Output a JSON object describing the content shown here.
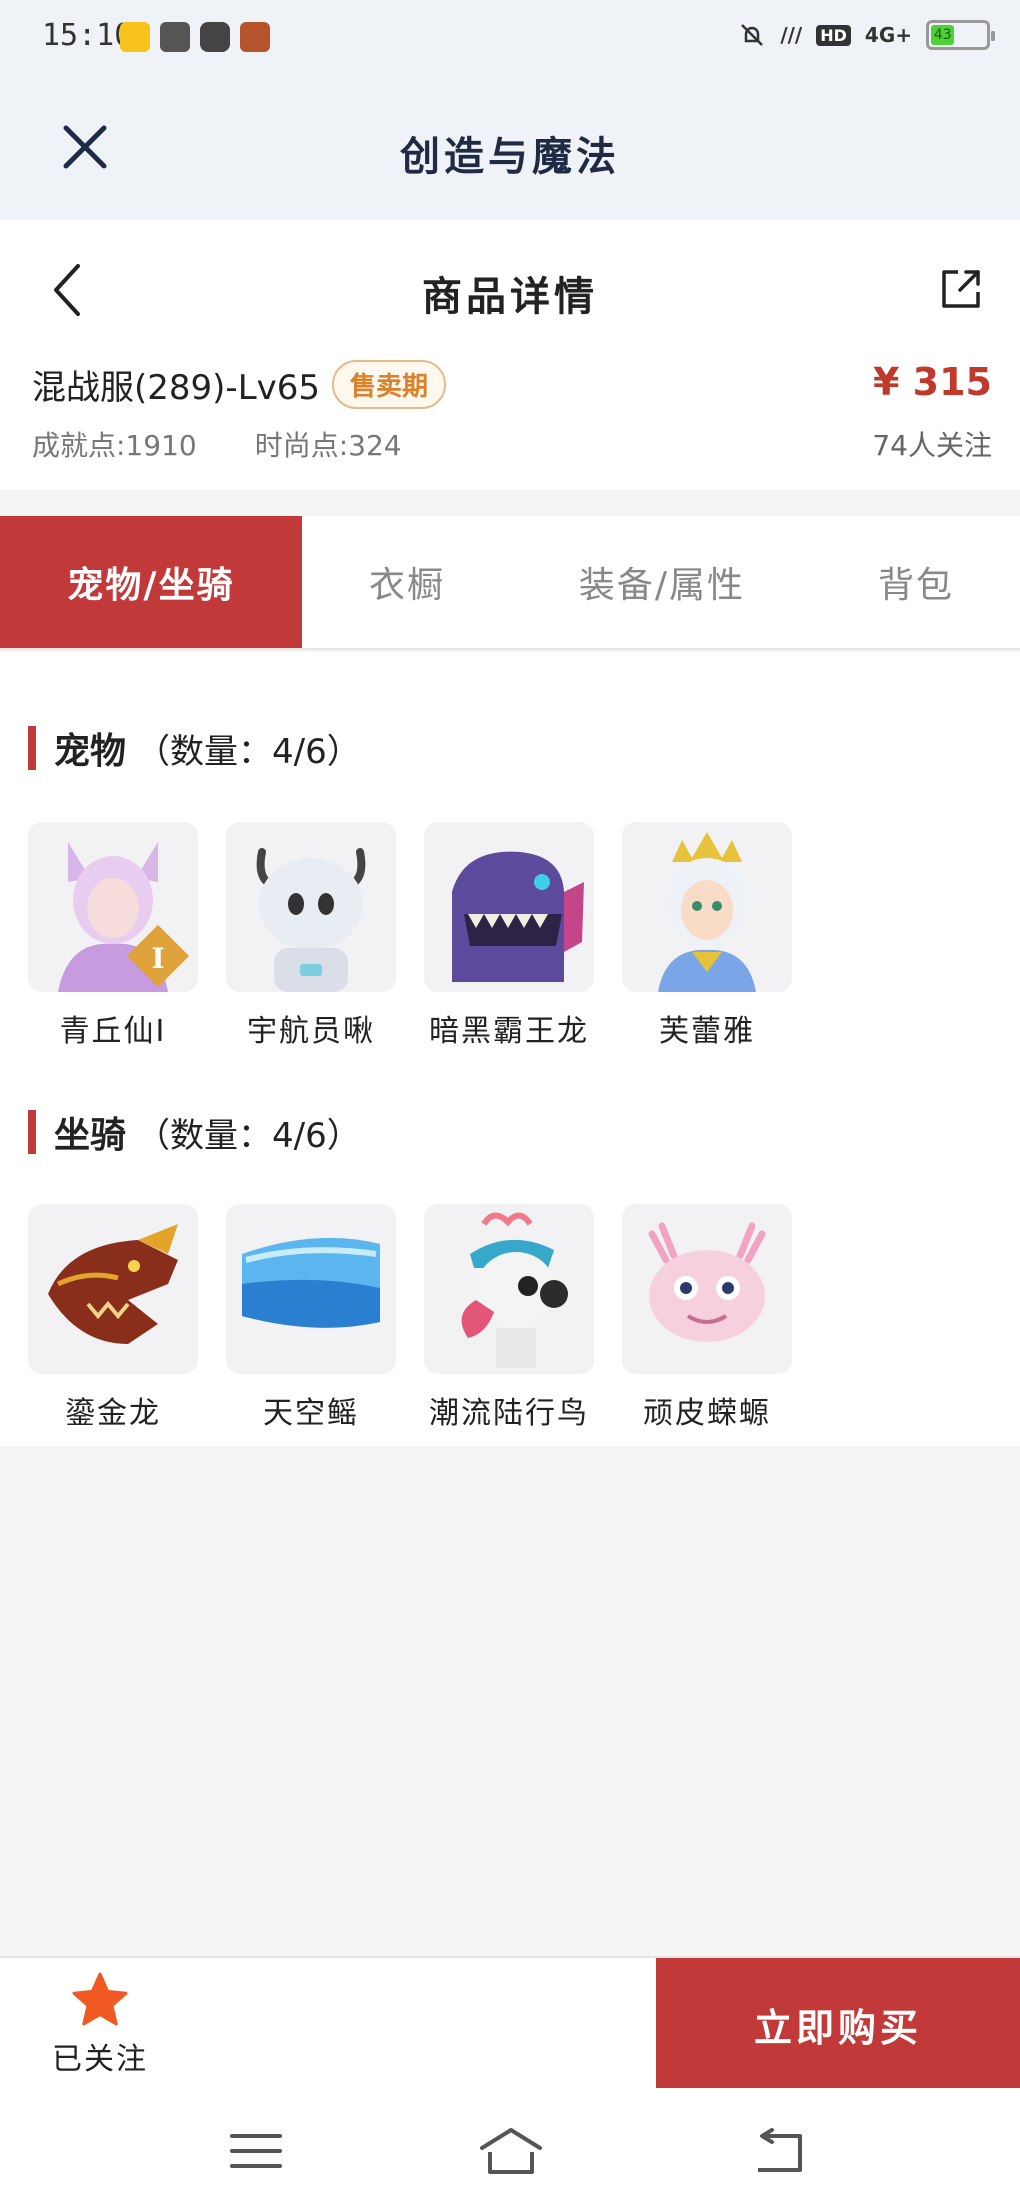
{
  "status_bar": {
    "time": "15:10",
    "network_label": "4G+",
    "hd_label": "HD",
    "battery_level": "43",
    "colors": {
      "battery": "#4cd137"
    }
  },
  "app_bar": {
    "title": "创造与魔法",
    "close_icon": "close-icon"
  },
  "header": {
    "page_title": "商品详情",
    "item_name": "混战服(289)-Lv65",
    "status_badge": "售卖期",
    "price": "¥ 315",
    "achievement_points": "成就点:1910",
    "fashion_points": "时尚点:324",
    "followers": "74人关注"
  },
  "tabs": [
    {
      "label": "宠物/坐骑",
      "active": true
    },
    {
      "label": "衣橱",
      "active": false
    },
    {
      "label": "装备/属性",
      "active": false
    },
    {
      "label": "背包",
      "active": false
    }
  ],
  "sections": {
    "pets": {
      "title": "宠物",
      "count_text": "（数量：4/6）",
      "items": [
        {
          "name": "青丘仙I",
          "icon": "fox-fairy-avatar"
        },
        {
          "name": "宇航员啾",
          "icon": "astronaut-avatar"
        },
        {
          "name": "暗黑霸王龙",
          "icon": "dark-trex-avatar"
        },
        {
          "name": "芙蕾雅",
          "icon": "freya-avatar"
        }
      ]
    },
    "mounts": {
      "title": "坐骑",
      "count_text": "（数量：4/6）",
      "items": [
        {
          "name": "鎏金龙",
          "icon": "golden-dragon-avatar"
        },
        {
          "name": "天空鳐",
          "icon": "sky-ray-avatar"
        },
        {
          "name": "潮流陆行鸟",
          "icon": "trendy-bird-avatar"
        },
        {
          "name": "顽皮蝾螈",
          "icon": "axolotl-avatar"
        }
      ]
    }
  },
  "action_bar": {
    "follow_label": "已关注",
    "buy_label": "立即购买"
  },
  "theme": {
    "accent": "#c2393a",
    "price": "#c0392b",
    "badge": "#d9822b",
    "follow_star": "#f05a22"
  }
}
